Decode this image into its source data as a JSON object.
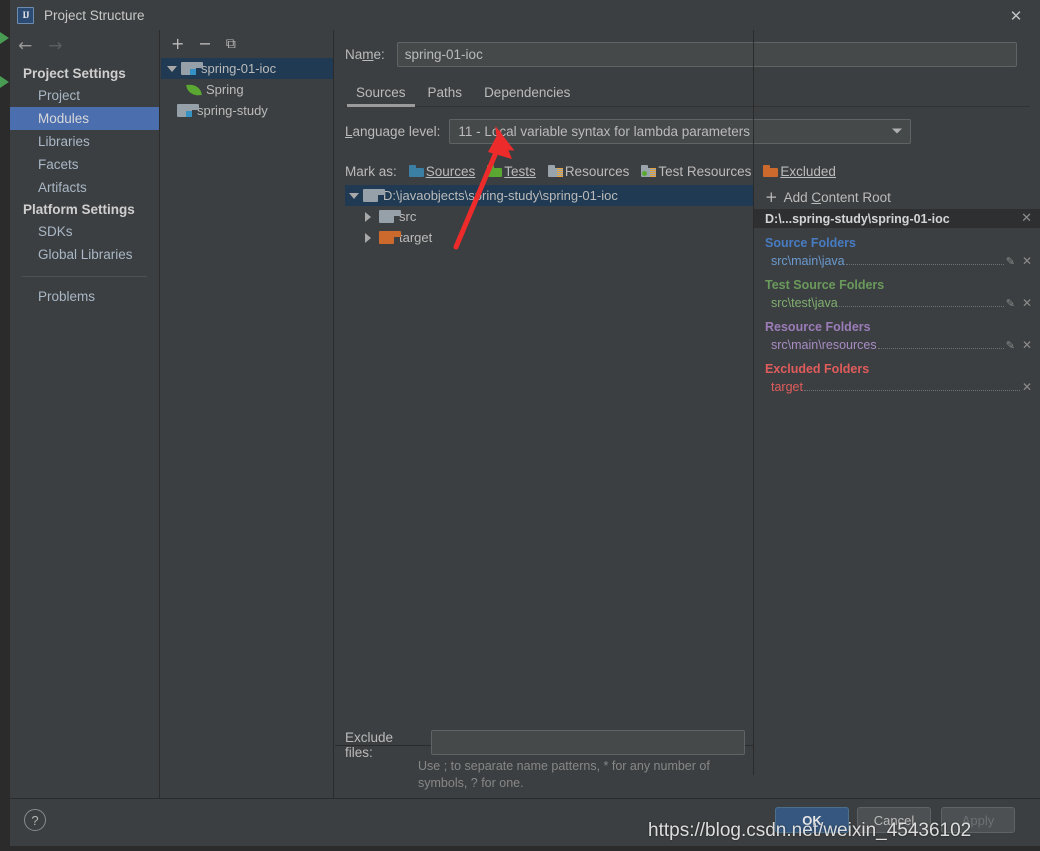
{
  "window": {
    "title": "Project Structure",
    "app_icon": "IJ",
    "close_icon": "✕"
  },
  "sidebar": {
    "back_icon": "←",
    "forward_icon": "→",
    "groups": [
      {
        "title": "Project Settings",
        "items": [
          {
            "label": "Project",
            "selected": false
          },
          {
            "label": "Modules",
            "selected": true
          },
          {
            "label": "Libraries",
            "selected": false
          },
          {
            "label": "Facets",
            "selected": false
          },
          {
            "label": "Artifacts",
            "selected": false
          }
        ]
      },
      {
        "title": "Platform Settings",
        "items": [
          {
            "label": "SDKs",
            "selected": false
          },
          {
            "label": "Global Libraries",
            "selected": false
          }
        ]
      }
    ],
    "problems_label": "Problems"
  },
  "modules_panel": {
    "toolbar": {
      "add_label": "+",
      "remove_label": "−",
      "copy_label": "⧉"
    },
    "tree": [
      {
        "label": "spring-01-ioc",
        "icon": "module-folder-icon",
        "selected": true,
        "expanded": true,
        "depth": 0
      },
      {
        "label": "Spring",
        "icon": "spring-leaf-icon",
        "selected": false,
        "depth": 1
      },
      {
        "label": "spring-study",
        "icon": "module-folder-icon",
        "selected": false,
        "depth": 0
      }
    ]
  },
  "detail": {
    "name_label": "Name:",
    "name_value": "spring-01-ioc",
    "tabs": [
      {
        "label": "Sources",
        "active": true
      },
      {
        "label": "Paths",
        "active": false
      },
      {
        "label": "Dependencies",
        "active": false
      }
    ],
    "language_level_label": "Language level:",
    "language_level_value": "11 - Local variable syntax for lambda parameters",
    "mark_as_label": "Mark as:",
    "mark_as_options": [
      {
        "label": "Sources",
        "color": "#3b7fa5"
      },
      {
        "label": "Tests",
        "color": "#5aa832"
      },
      {
        "label": "Resources",
        "color": "#9aa4ab"
      },
      {
        "label": "Test Resources",
        "color": "#9aa4ab"
      },
      {
        "label": "Excluded",
        "color": "#cc6a2e"
      }
    ],
    "content_tree": [
      {
        "label": "D:\\javaobjects\\spring-study\\spring-01-ioc",
        "expanded": true,
        "selected": true,
        "depth": 0,
        "color": "#96a0a8"
      },
      {
        "label": "src",
        "expanded": false,
        "selected": false,
        "depth": 1,
        "color": "#96a0a8"
      },
      {
        "label": "target",
        "expanded": false,
        "selected": false,
        "depth": 1,
        "color": "#cc6a2e"
      }
    ],
    "exclude_files_label": "Exclude files:",
    "exclude_files_value": "",
    "exclude_hint": "Use ; to separate name patterns, * for any number of symbols, ? for one."
  },
  "content_root_panel": {
    "add_content_root_label": "Add Content Root",
    "add_icon": "+",
    "root_title": "D:\\...spring-study\\spring-01-ioc",
    "root_close_icon": "✕",
    "sections": [
      {
        "title": "Source Folders",
        "kind": "src",
        "items": [
          {
            "path": "src\\main\\java",
            "has_edit": true,
            "has_remove": true
          }
        ]
      },
      {
        "title": "Test Source Folders",
        "kind": "test",
        "items": [
          {
            "path": "src\\test\\java",
            "has_edit": true,
            "has_remove": true
          }
        ]
      },
      {
        "title": "Resource Folders",
        "kind": "res",
        "items": [
          {
            "path": "src\\main\\resources",
            "has_edit": true,
            "has_remove": true
          }
        ]
      },
      {
        "title": "Excluded Folders",
        "kind": "excl",
        "items": [
          {
            "path": "target",
            "has_edit": false,
            "has_remove": true
          }
        ]
      }
    ],
    "edit_icon": "✎",
    "remove_icon": "✕"
  },
  "footer": {
    "help_label": "?",
    "ok_label": "OK",
    "cancel_label": "Cancel",
    "apply_label": "Apply"
  },
  "overlay": {
    "watermark": "https://blog.csdn.net/weixin_45436102",
    "arrow_color": "#ee2b2b"
  },
  "colors": {
    "background": "#3c3f41",
    "selection_blue": "#4b6eaf",
    "tree_selection": "#1f3a52",
    "primary_button": "#365880"
  }
}
